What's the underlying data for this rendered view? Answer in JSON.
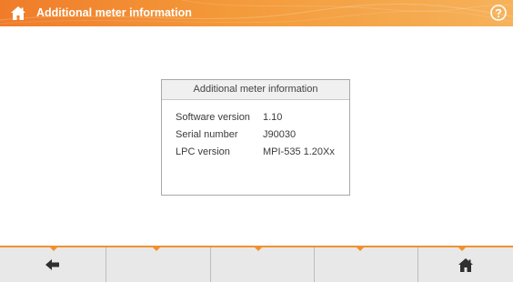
{
  "header": {
    "title": "Additional meter information",
    "home_icon": "home-icon",
    "help_icon": "help-icon",
    "accent_color": "#f0912f"
  },
  "dialog": {
    "title": "Additional meter information",
    "rows": [
      {
        "label": "Software version",
        "value": "1.10"
      },
      {
        "label": "Serial number",
        "value": "J90030"
      },
      {
        "label": "LPC version",
        "value": "MPI-535 1.20Xx"
      }
    ]
  },
  "footer": {
    "buttons": [
      {
        "icon": "back-arrow-icon"
      },
      {
        "icon": ""
      },
      {
        "icon": ""
      },
      {
        "icon": ""
      },
      {
        "icon": "home-icon"
      }
    ]
  }
}
